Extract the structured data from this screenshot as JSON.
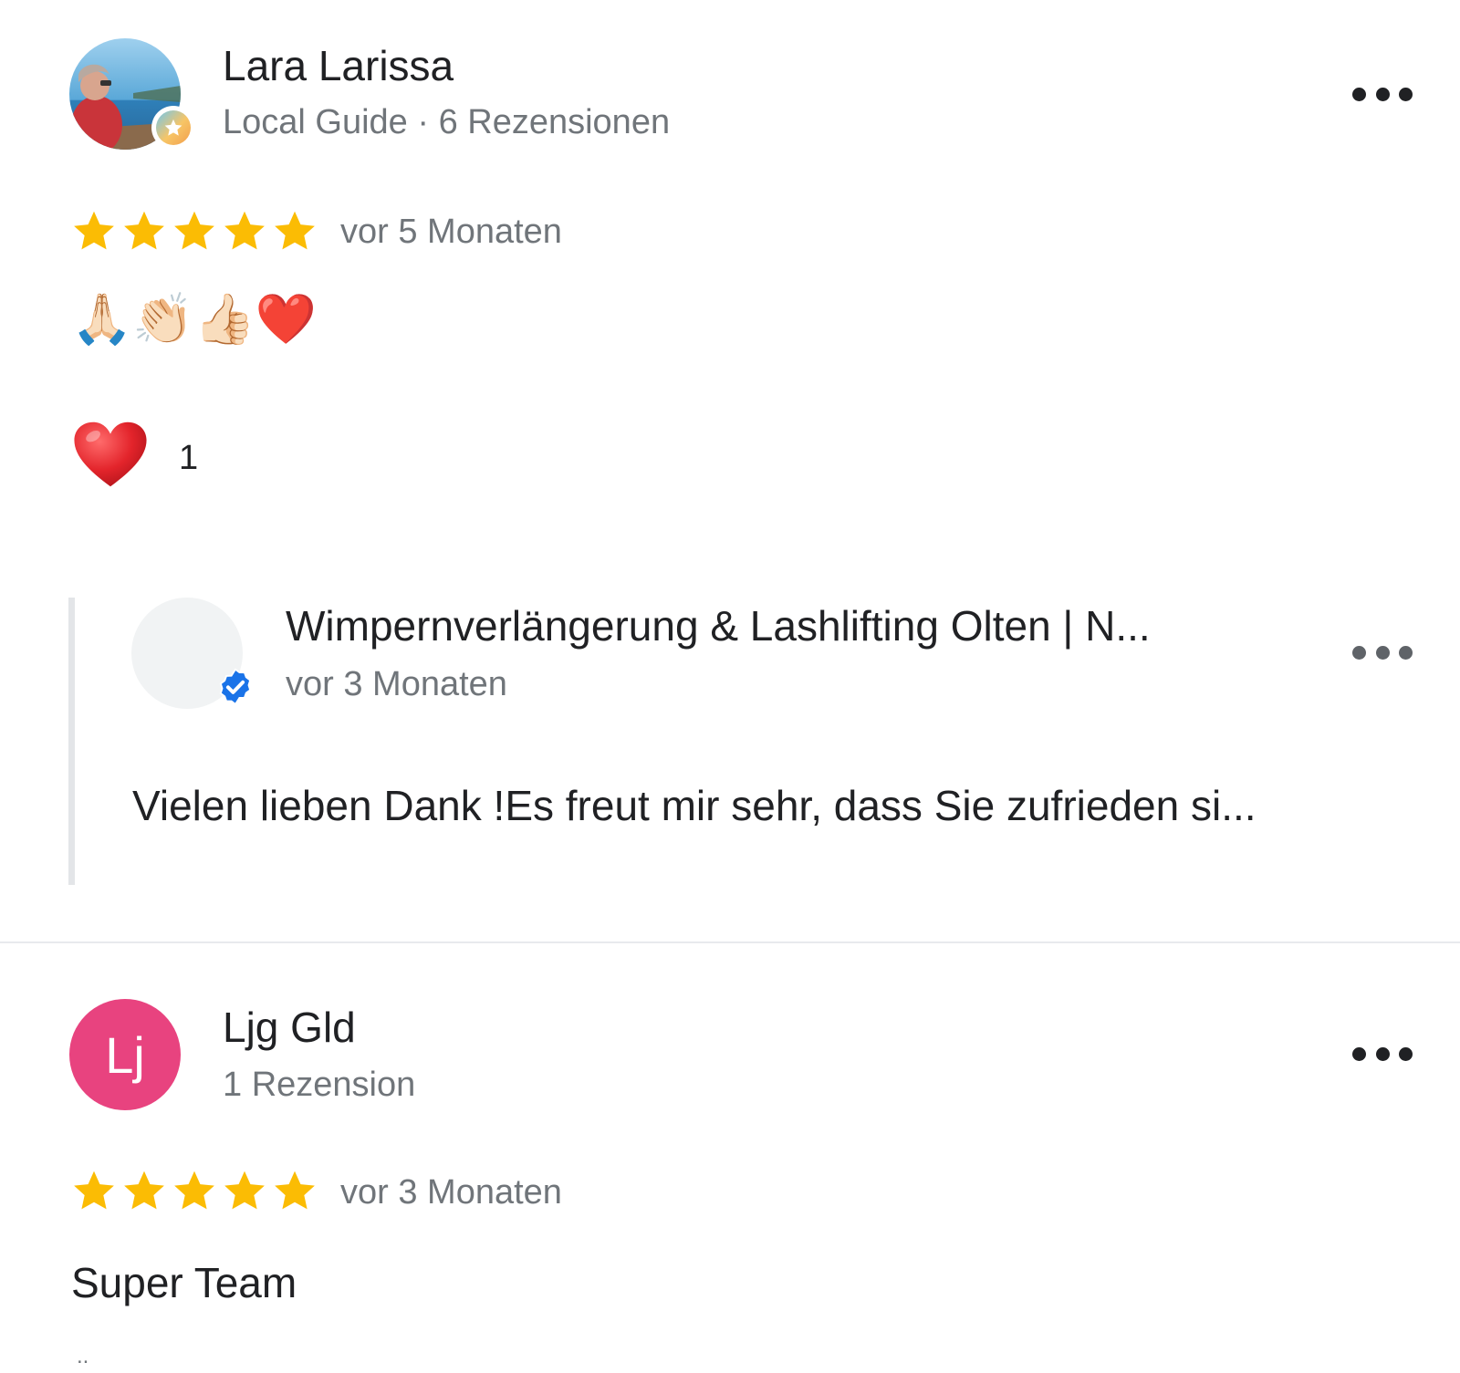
{
  "reviews": [
    {
      "author_name": "Lara Larissa",
      "author_meta": "Local Guide · 6 Rezensionen",
      "rating": 5,
      "date": "vor 5 Monaten",
      "text": "🙏🏻👏🏻👍🏻❤️",
      "reaction_count": "1",
      "owner_reply": {
        "name": "Wimpernverlängerung & Lashlifting Olten | N...",
        "date": "vor 3 Monaten",
        "text": "Vielen lieben Dank !Es freut mir sehr, dass Sie zufrieden si..."
      }
    },
    {
      "author_name": "Ljg Gld",
      "author_initials": "Lj",
      "author_meta": "1 Rezension",
      "rating": 5,
      "date": "vor 3 Monaten",
      "text": "Super Team",
      "text_more": ".."
    }
  ],
  "colors": {
    "star": "#fbbc04",
    "secondary_text": "#70757a",
    "avatar_pink": "#e8437f",
    "verified_blue": "#1a73e8",
    "heart_red": "#e3242b"
  }
}
